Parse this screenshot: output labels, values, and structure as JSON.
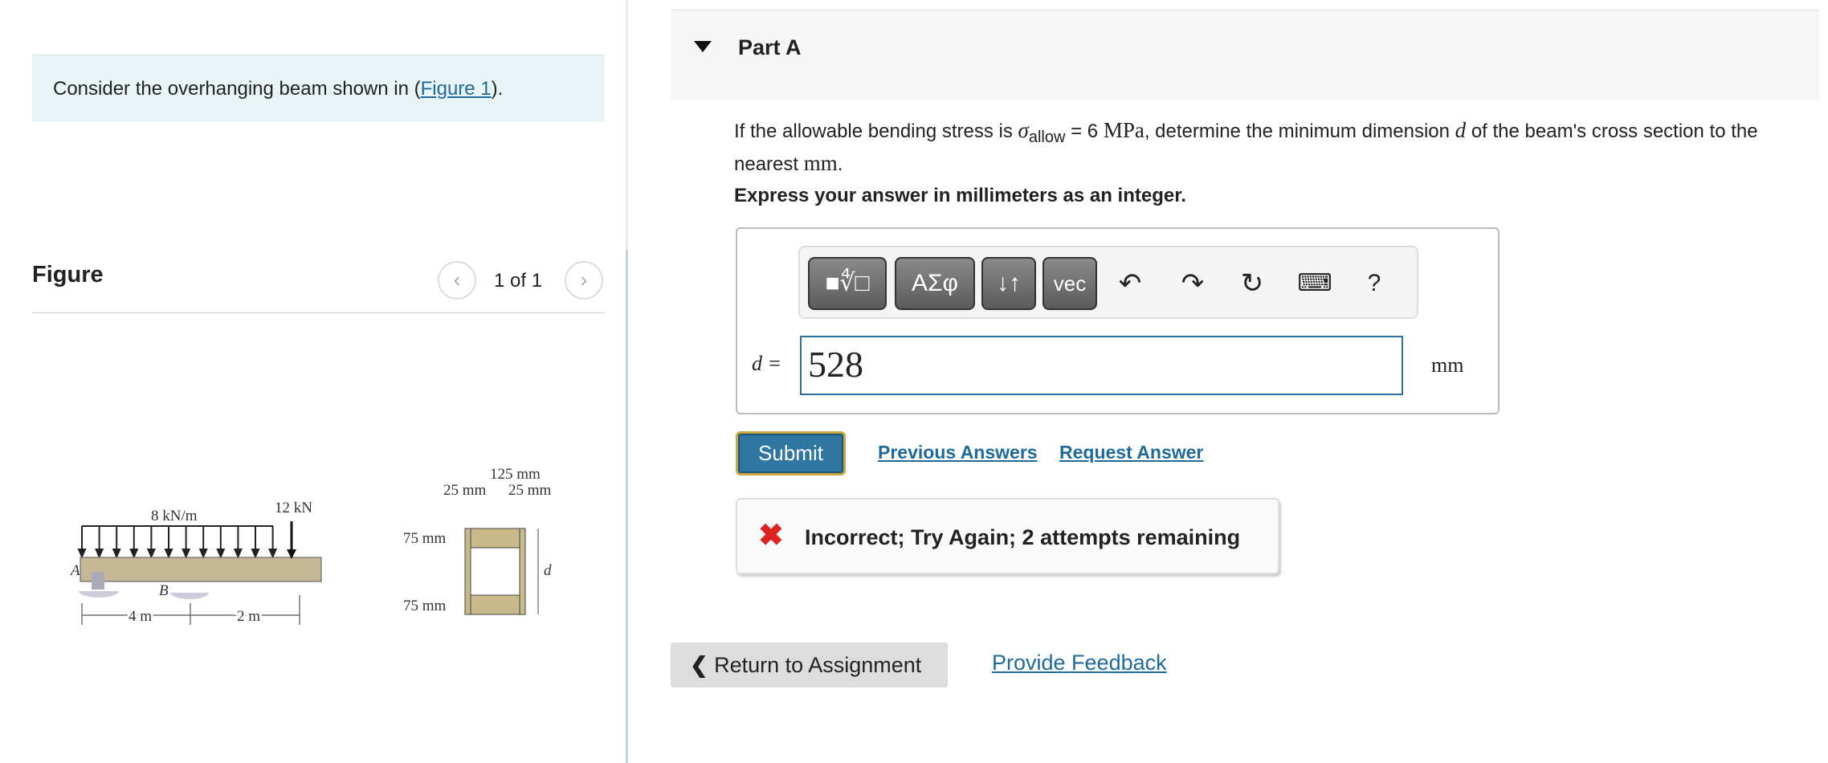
{
  "intro": {
    "text_before": "Consider the overhanging beam shown in (",
    "link": "Figure 1",
    "text_after": ")."
  },
  "figure": {
    "title": "Figure",
    "pager": "1 of 1",
    "prev_icon": "chevron-left-icon",
    "next_icon": "chevron-right-icon",
    "labels": {
      "distributed_load": "8 kN/m",
      "point_load": "12 kN",
      "support_a": "A",
      "support_b": "B",
      "span_ab": "4 m",
      "overhang": "2 m",
      "width_total": "125 mm",
      "flange_left": "25 mm",
      "flange_right": "25 mm",
      "top_depth": "75 mm",
      "bottom_depth": "75 mm",
      "depth": "d"
    }
  },
  "part": {
    "title": "Part A",
    "question": {
      "p1": "If the allowable bending stress is ",
      "sigma": "σ",
      "sub": "allow",
      "p2": " = 6 ",
      "unit": "MPa",
      "p3": ", determine the minimum dimension ",
      "d": "d",
      "p4": " of the beam's cross section to the nearest ",
      "unit2": "mm",
      "p5": "."
    },
    "instruction": "Express your answer in millimeters as an integer.",
    "toolbar": {
      "templates_icon": "■∜□",
      "greek": "ΑΣφ",
      "arrows": "↓↑",
      "vec": "vec",
      "undo_icon": "undo-icon",
      "redo_icon": "redo-icon",
      "reset_icon": "reset-icon",
      "keyboard_icon": "keyboard-icon",
      "help": "?"
    },
    "answer": {
      "label": "d =",
      "value": "528",
      "unit": "mm"
    },
    "submit": "Submit",
    "previous_answers": "Previous Answers",
    "request_answer": "Request Answer",
    "feedback": {
      "icon": "✖",
      "text": "Incorrect; Try Again; 2 attempts remaining",
      "color": "#dd2222"
    }
  },
  "footer": {
    "return": "Return to Assignment",
    "provide_feedback": "Provide Feedback"
  }
}
